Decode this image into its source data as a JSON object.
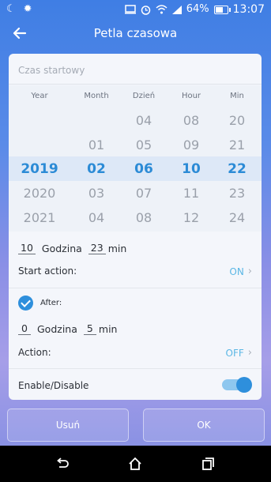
{
  "status_bar": {
    "battery_percent_text": "64%",
    "battery_level": 0.64,
    "time": "13:07",
    "icons": [
      "moon-icon",
      "settings-gear-icon",
      "cast-icon",
      "alarm-icon",
      "wifi-icon",
      "signal-icon",
      "battery-icon"
    ]
  },
  "app_bar": {
    "title": "Petla czasowa"
  },
  "start_time": {
    "placeholder": "Czas startowy"
  },
  "picker": {
    "headers": [
      "Year",
      "Month",
      "Dzień",
      "Hour",
      "Min"
    ],
    "columns": [
      [
        "",
        "",
        "2019",
        "2020",
        "2021"
      ],
      [
        "",
        "01",
        "02",
        "03",
        "04"
      ],
      [
        "04",
        "05",
        "06",
        "07",
        "08"
      ],
      [
        "08",
        "09",
        "10",
        "11",
        "12"
      ],
      [
        "20",
        "21",
        "22",
        "23",
        "24"
      ]
    ],
    "selected_row": 2
  },
  "start_block": {
    "hours": "10",
    "hours_label": "Godzina",
    "minutes": "23",
    "minutes_label": "min",
    "start_action_label": "Start action:",
    "start_action_value": "ON"
  },
  "after_block": {
    "after_label": "After:",
    "after_checked": true,
    "hours": "0",
    "hours_label": "Godzina",
    "minutes": "5",
    "minutes_label": "min",
    "action_label": "Action:",
    "action_value": "OFF"
  },
  "enable": {
    "label": "Enable/Disable",
    "enabled": true
  },
  "buttons": {
    "delete": "Usuń",
    "ok": "OK"
  },
  "colors": {
    "accent": "#2e8fdc",
    "value_text": "#5bb7e5"
  }
}
